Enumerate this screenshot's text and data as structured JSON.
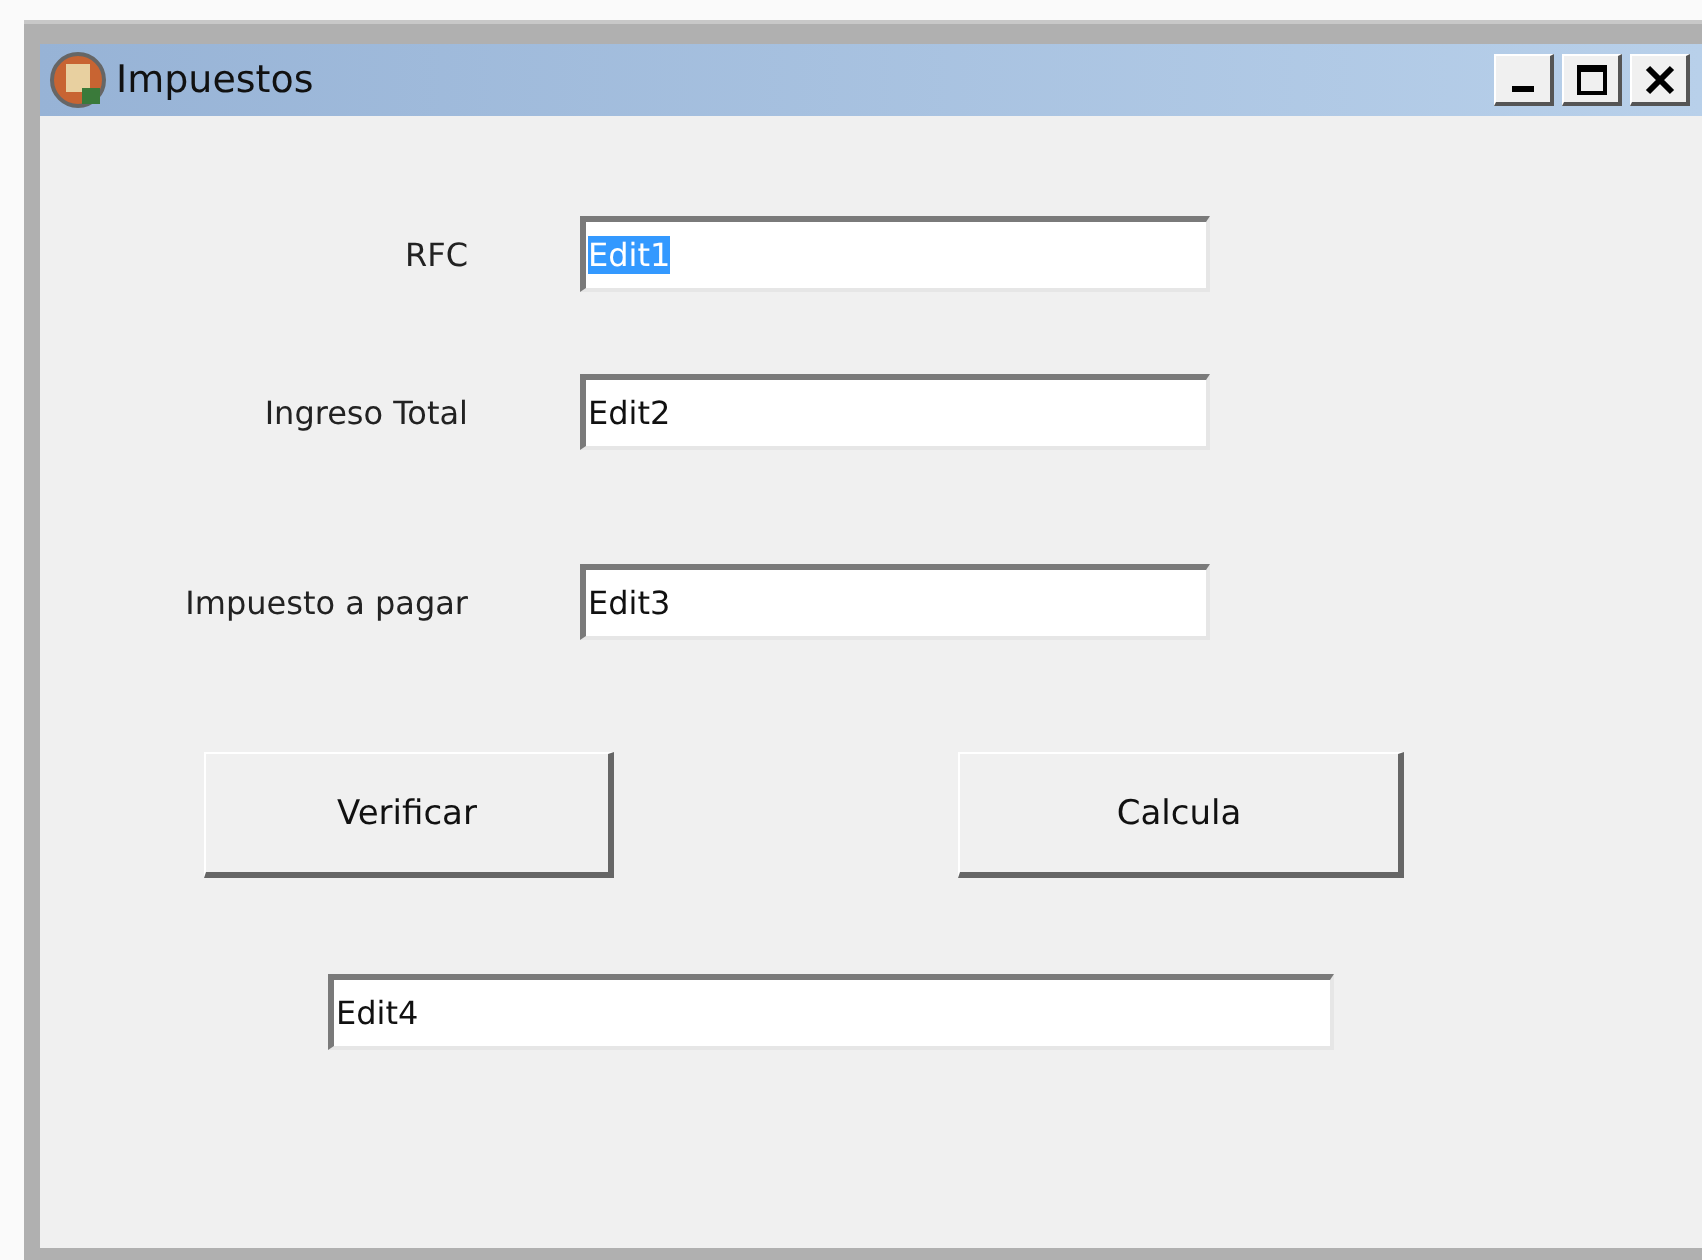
{
  "window": {
    "title": "Impuestos",
    "controls": [
      {
        "kind": "minimize"
      },
      {
        "kind": "maximize"
      },
      {
        "kind": "close"
      }
    ]
  },
  "fields": [
    {
      "label": "RFC",
      "value": "Edit1",
      "text_selected": true
    },
    {
      "label": "Ingreso Total",
      "value": "Edit2",
      "text_selected": false
    },
    {
      "label": "Impuesto a pagar",
      "value": "Edit3",
      "text_selected": false
    }
  ],
  "buttons": [
    "Verificar",
    "Calcula"
  ],
  "output": {
    "value": "Edit4"
  }
}
